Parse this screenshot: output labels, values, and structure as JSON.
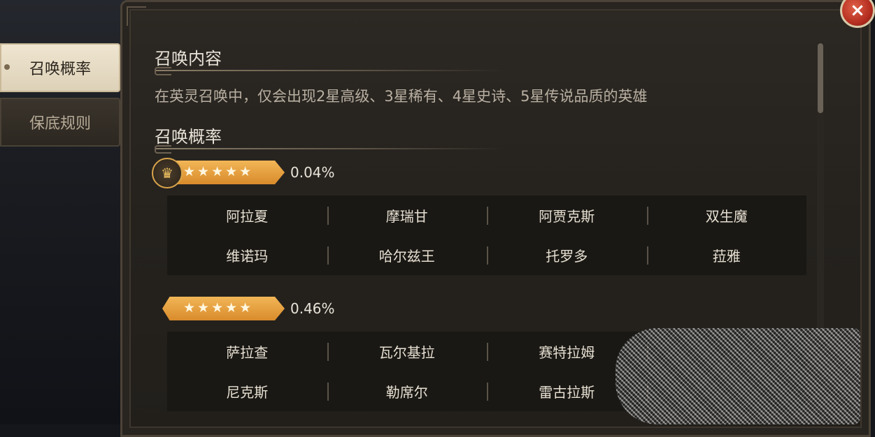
{
  "tabs": [
    {
      "label": "召唤概率",
      "active": true
    },
    {
      "label": "保底规则",
      "active": false
    }
  ],
  "close_label": "×",
  "content_title": "召唤内容",
  "content_desc": "在英灵召唤中，仅会出现2星高级、3星稀有、4星史诗、5星传说品质的英雄",
  "rate_title": "召唤概率",
  "groups": [
    {
      "stars": "★★★★★",
      "rate": "0.04%",
      "has_crown": true,
      "heroes": [
        [
          "阿拉夏",
          "摩瑞甘",
          "阿贾克斯",
          "双生魔"
        ],
        [
          "维诺玛",
          "哈尔兹王",
          "托罗多",
          "菈雅"
        ]
      ]
    },
    {
      "stars": "★★★★★",
      "rate": "0.46%",
      "has_crown": false,
      "heroes": [
        [
          "萨拉查",
          "瓦尔基拉",
          "赛特拉姆",
          ""
        ],
        [
          "尼克斯",
          "勒席尔",
          "雷古拉斯",
          ""
        ]
      ]
    }
  ],
  "colors": {
    "accent": "#d98b2b",
    "panel": "#25221e",
    "text": "#e9e3d8"
  }
}
